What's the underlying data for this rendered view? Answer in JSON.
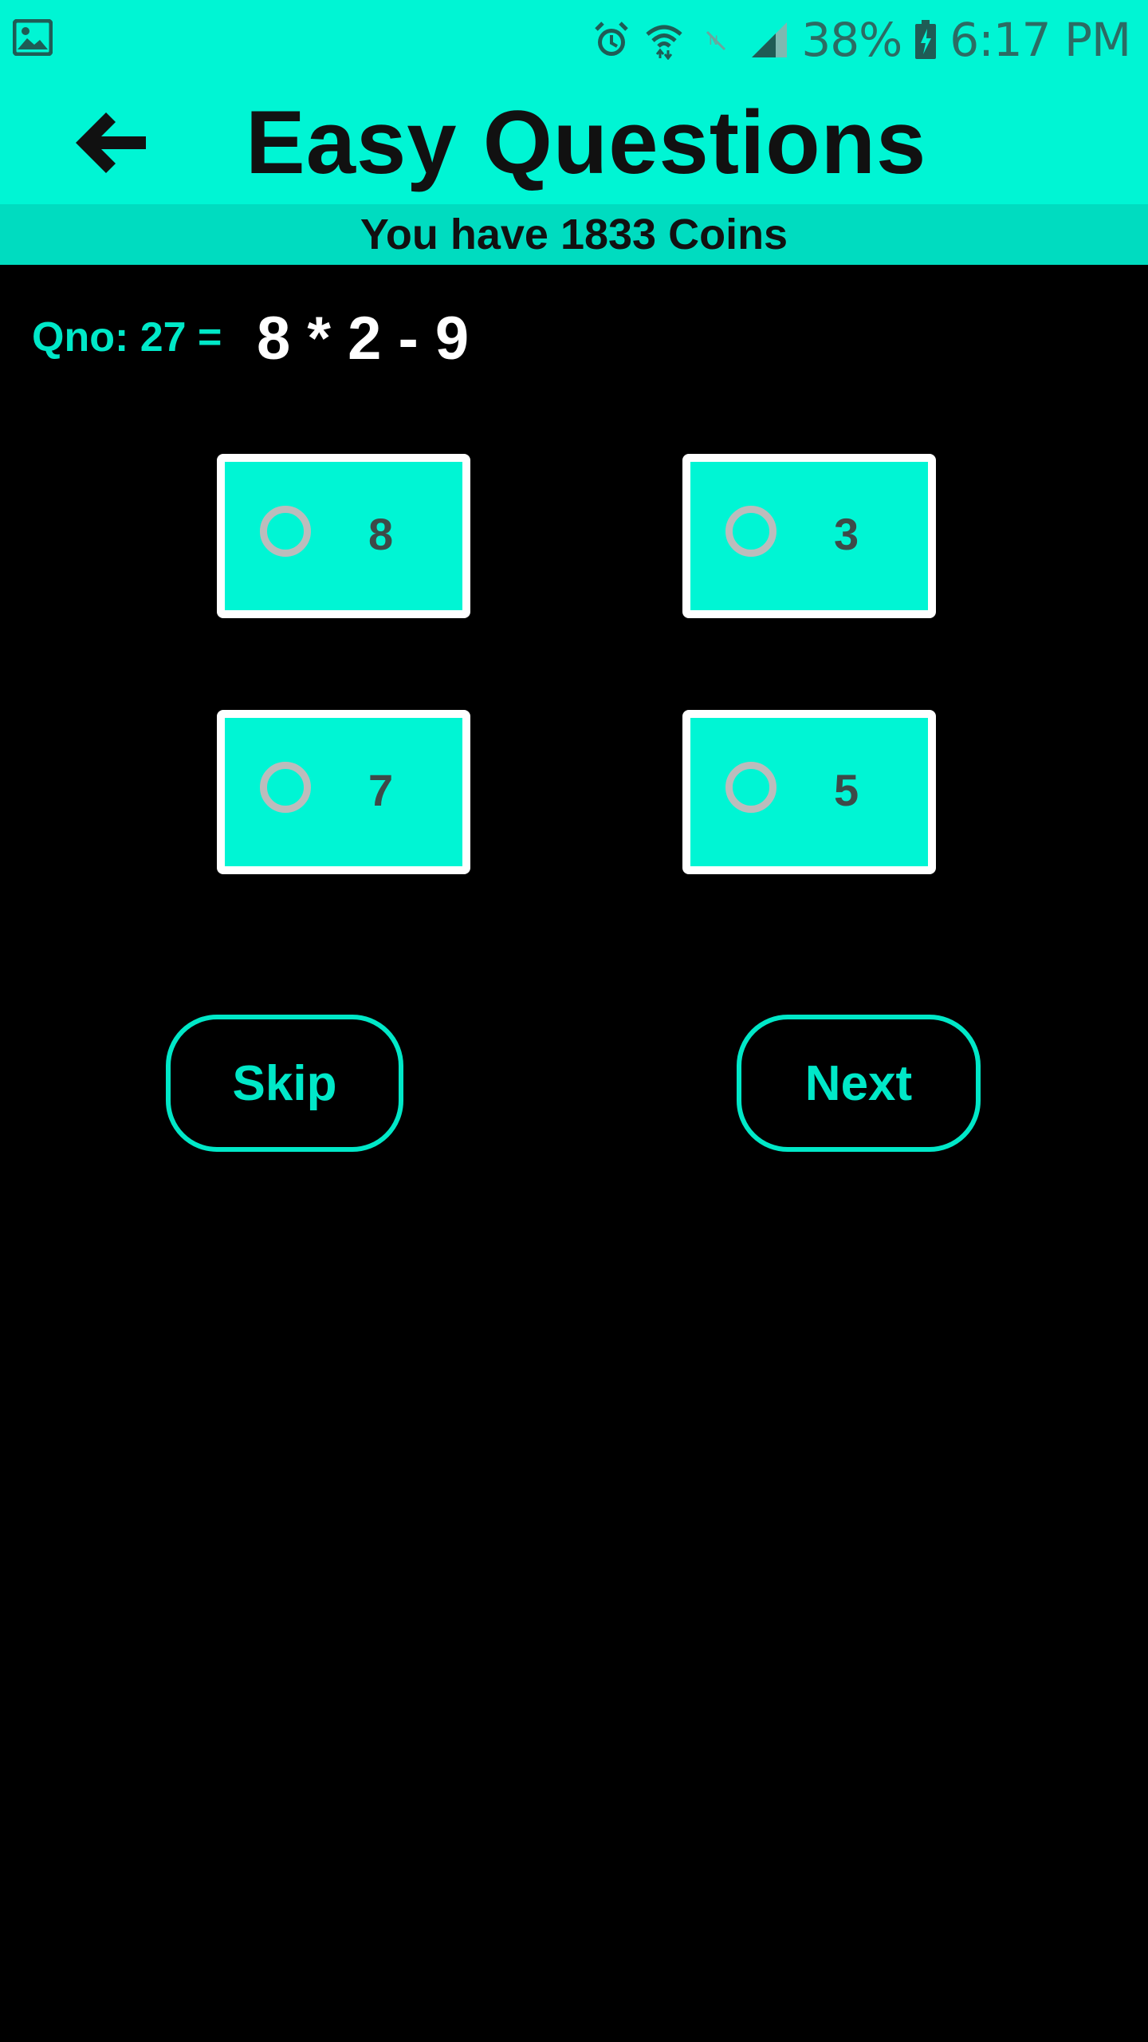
{
  "status_bar": {
    "battery": "38%",
    "time": "6:17 PM",
    "icons": [
      "image-icon",
      "alarm-icon",
      "wifi-icon",
      "nfc-off-icon",
      "signal-icon",
      "battery-charging-icon"
    ]
  },
  "app_bar": {
    "title": "Easy Questions",
    "back_icon": "arrow-left-icon"
  },
  "coins": {
    "text": "You have 1833 Coins"
  },
  "question": {
    "label": "Qno: 27 =",
    "expression": "8 * 2 - 9"
  },
  "options": [
    {
      "label": "8"
    },
    {
      "label": "3"
    },
    {
      "label": "7"
    },
    {
      "label": "5"
    }
  ],
  "buttons": {
    "skip": "Skip",
    "next": "Next"
  },
  "colors": {
    "accent": "#00f5d4",
    "accent_dark": "#00dcc0",
    "background": "#000000"
  }
}
